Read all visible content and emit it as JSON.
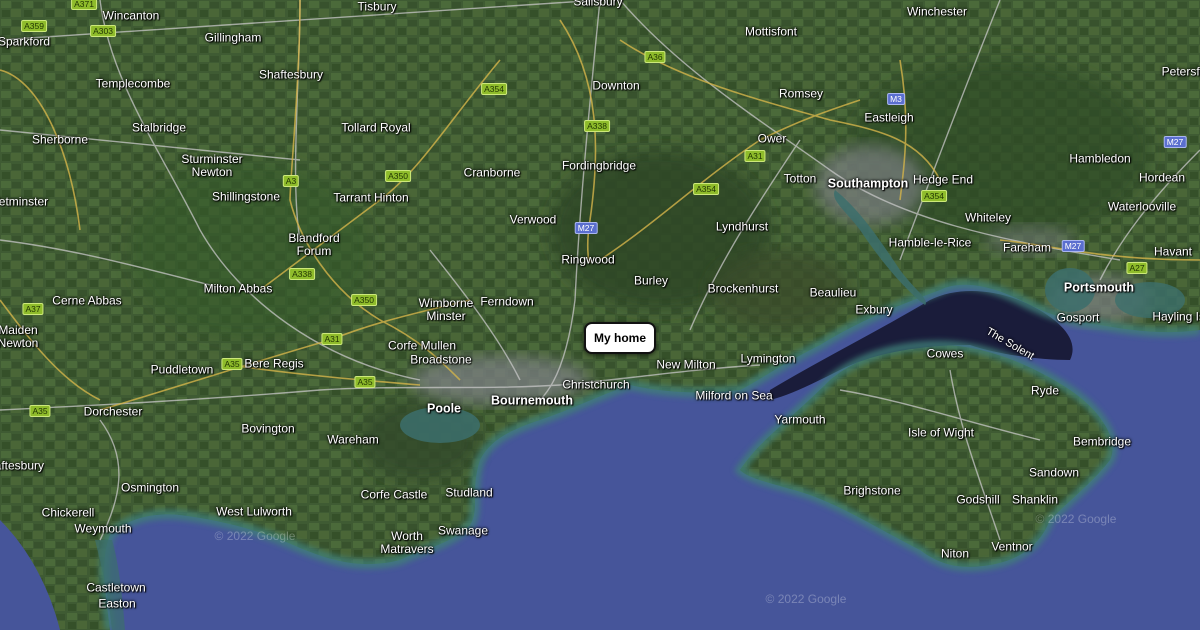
{
  "map": {
    "colors": {
      "land": "#3f5b33",
      "sea": "#46559a",
      "solent": "#1a1c3a",
      "shallows": "#3f7f78",
      "roads": "#c7c7c7"
    },
    "marker": {
      "label": "My home"
    },
    "solent_label": "The Solent",
    "copyright": "© 2022 Google",
    "places": [
      {
        "text": "Salisbury"
      },
      {
        "text": "Tisbury"
      },
      {
        "text": "Wincanton"
      },
      {
        "text": "Sparkford"
      },
      {
        "text": "Gillingham"
      },
      {
        "text": "Winchester"
      },
      {
        "text": "Mottisfont"
      },
      {
        "text": "Shaftesbury"
      },
      {
        "text": "Templecombe"
      },
      {
        "text": "Downton"
      },
      {
        "text": "Romsey"
      },
      {
        "text": "Petersfield"
      },
      {
        "text": "Eastleigh"
      },
      {
        "text": "Stalbridge"
      },
      {
        "text": "Tollard Royal"
      },
      {
        "text": "Sherborne"
      },
      {
        "text": "Ower"
      },
      {
        "text": "Sturminster\nNewton"
      },
      {
        "text": "Fordingbridge"
      },
      {
        "text": "Hambledon"
      },
      {
        "text": "Cranborne"
      },
      {
        "text": "Totton"
      },
      {
        "text": "Southampton"
      },
      {
        "text": "Hedge End"
      },
      {
        "text": "Hordean"
      },
      {
        "text": "Shillingstone"
      },
      {
        "text": "Tarrant Hinton"
      },
      {
        "text": "Yetminster"
      },
      {
        "text": "Waterlooville"
      },
      {
        "text": "Verwood"
      },
      {
        "text": "Whiteley"
      },
      {
        "text": "Lyndhurst"
      },
      {
        "text": "Blandford\nForum"
      },
      {
        "text": "Hamble-le-Rice"
      },
      {
        "text": "Fareham"
      },
      {
        "text": "Havant"
      },
      {
        "text": "Ringwood"
      },
      {
        "text": "Burley"
      },
      {
        "text": "Milton Abbas"
      },
      {
        "text": "Brockenhurst"
      },
      {
        "text": "Beaulieu"
      },
      {
        "text": "Portsmouth"
      },
      {
        "text": "Cerne Abbas"
      },
      {
        "text": "Ferndown"
      },
      {
        "text": "Wimborne\nMinster"
      },
      {
        "text": "Exbury"
      },
      {
        "text": "Gosport"
      },
      {
        "text": "Hayling Island"
      },
      {
        "text": "Maiden\nNewton"
      },
      {
        "text": "Corfe Mullen"
      },
      {
        "text": "Broadstone"
      },
      {
        "text": "Cowes"
      },
      {
        "text": "Lymington"
      },
      {
        "text": "New Milton"
      },
      {
        "text": "Puddletown"
      },
      {
        "text": "Bere Regis"
      },
      {
        "text": "Christchurch"
      },
      {
        "text": "Ryde"
      },
      {
        "text": "Milford on Sea"
      },
      {
        "text": "Poole"
      },
      {
        "text": "Bournemouth"
      },
      {
        "text": "Dorchester"
      },
      {
        "text": "Yarmouth"
      },
      {
        "text": "Bovington"
      },
      {
        "text": "Isle of Wight"
      },
      {
        "text": "Bembridge"
      },
      {
        "text": "Wareham"
      },
      {
        "text": "Sandown"
      },
      {
        "text": "Shaftesbury"
      },
      {
        "text": "Osmington"
      },
      {
        "text": "Brighstone"
      },
      {
        "text": "Corfe Castle"
      },
      {
        "text": "Studland"
      },
      {
        "text": "Godshill"
      },
      {
        "text": "Shanklin"
      },
      {
        "text": "Chickerell"
      },
      {
        "text": "West Lulworth"
      },
      {
        "text": "Weymouth"
      },
      {
        "text": "Swanage"
      },
      {
        "text": "Worth\nMatravers"
      },
      {
        "text": "Ventnor"
      },
      {
        "text": "Niton"
      },
      {
        "text": "Castletown"
      },
      {
        "text": "Easton"
      }
    ],
    "roads": [
      {
        "text": "A359"
      },
      {
        "text": "A371"
      },
      {
        "text": "A303"
      },
      {
        "text": "A36"
      },
      {
        "text": "A354"
      },
      {
        "text": "A338"
      },
      {
        "text": "M3"
      },
      {
        "text": "M27"
      },
      {
        "text": "A3"
      },
      {
        "text": "A350"
      },
      {
        "text": "A354"
      },
      {
        "text": "A31"
      },
      {
        "text": "M27"
      },
      {
        "text": "A338"
      },
      {
        "text": "A354"
      },
      {
        "text": "M27"
      },
      {
        "text": "A27"
      },
      {
        "text": "A37"
      },
      {
        "text": "A350"
      },
      {
        "text": "A31"
      },
      {
        "text": "A35"
      },
      {
        "text": "A35"
      },
      {
        "text": "A35"
      }
    ]
  }
}
